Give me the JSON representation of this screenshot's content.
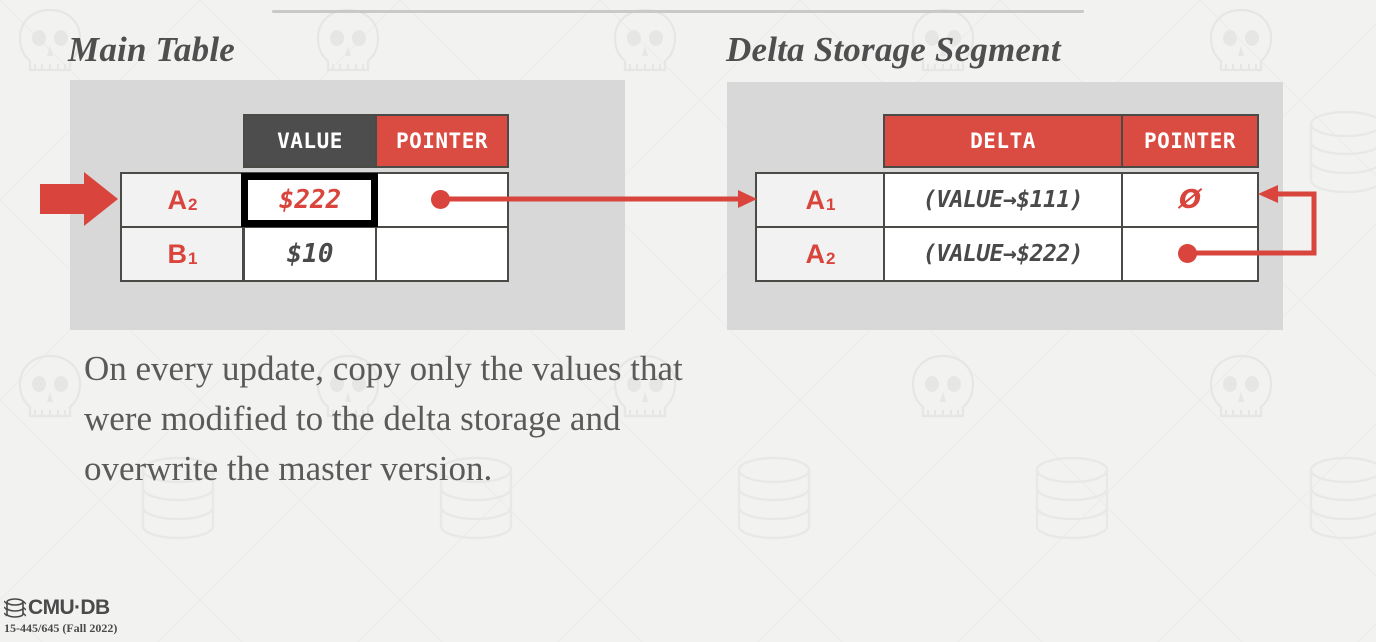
{
  "slide": {
    "top_rule": "horizontal-rule",
    "body_text": "On every update, copy only the values that were modified to the delta storage and overwrite the master version."
  },
  "main_table": {
    "title": "Main Table",
    "columns": [
      "",
      "VALUE",
      "POINTER"
    ],
    "rows": [
      {
        "key": "A",
        "key_sub": "2",
        "value": "$222",
        "pointer": "pointer-dot",
        "highlighted": true
      },
      {
        "key": "B",
        "key_sub": "1",
        "value": "$10",
        "pointer": "",
        "highlighted": false
      }
    ]
  },
  "delta_table": {
    "title": "Delta Storage Segment",
    "columns": [
      "",
      "DELTA",
      "POINTER"
    ],
    "rows": [
      {
        "key": "A",
        "key_sub": "1",
        "delta": "(VALUE→$111)",
        "pointer": "Ø"
      },
      {
        "key": "A",
        "key_sub": "2",
        "delta": "(VALUE→$222)",
        "pointer": "pointer-dot"
      }
    ]
  },
  "annotations": {
    "input_arrow": "red-arrow-right",
    "main_to_delta_arrow": "pointer-link-arrow",
    "delta_chain_arrow": "version-chain-arrow"
  },
  "footer": {
    "brand": "CMU·DB",
    "course": "15-445/645 (Fall 2022)"
  },
  "colors": {
    "accent_red": "#d9453c",
    "header_dark": "#4d4d4d",
    "panel_gray": "#d8d8d8",
    "page_bg": "#f2f2f1",
    "text_gray": "#5a5a5a"
  }
}
